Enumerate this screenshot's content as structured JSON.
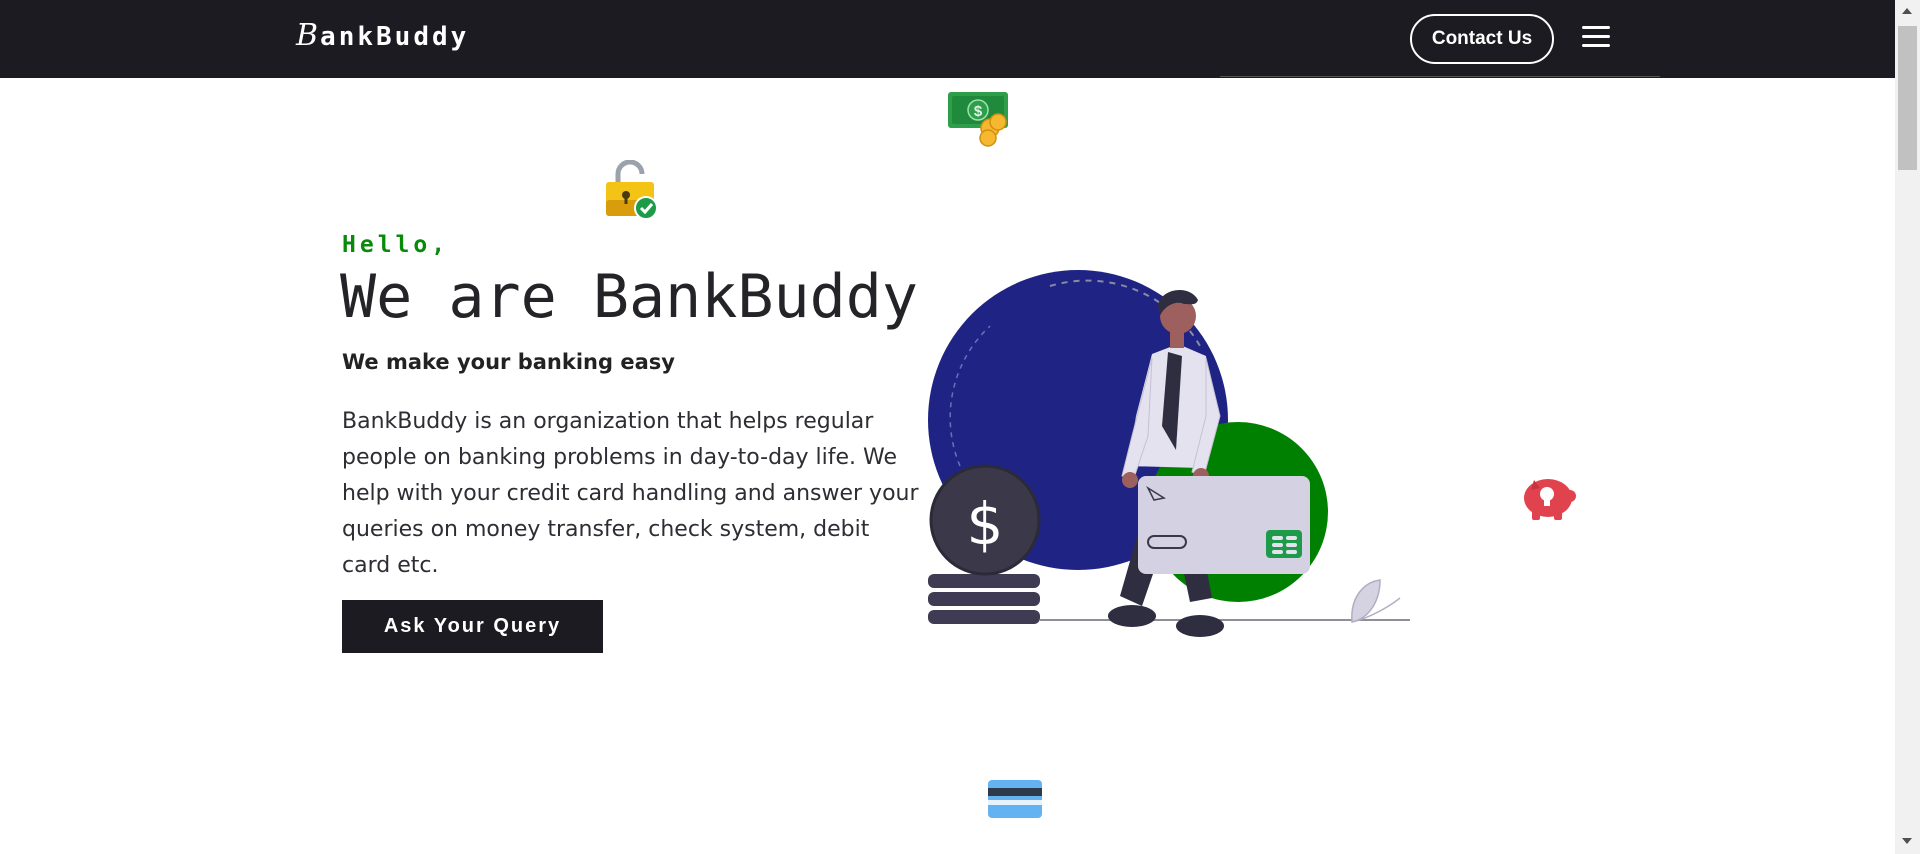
{
  "navbar": {
    "brand_mark": "B",
    "brand_text": "ankBuddy",
    "contact_label": "Contact Us",
    "menu_icon": "hamburger-menu-icon"
  },
  "hero": {
    "greeting": "Hello,",
    "headline": "We are BankBuddy",
    "subheading": "We make your banking easy",
    "description": "BankBuddy is an organization that helps regular people on banking problems in day-to-day life. We help with your credit card handling and answer your queries on money transfer, check system, debit card etc.",
    "cta_label": "Ask Your Query"
  },
  "floating_icons": [
    "money-bill-coins-icon",
    "unlocked-padlock-icon",
    "piggy-bank-icon",
    "credit-card-icon"
  ],
  "illustration": {
    "icon": "$",
    "name": "person-with-credit-card-illustration"
  },
  "colors": {
    "navbar_bg": "#1c1b22",
    "accent_green": "#0a8a0a",
    "circle_blue": "#1f2484",
    "circle_green": "#008000",
    "button_dark": "#1c1b22"
  }
}
